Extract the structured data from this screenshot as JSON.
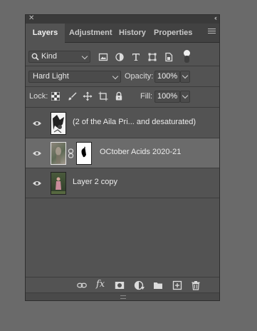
{
  "titlebar": {
    "close_glyph": "✕",
    "collapse_glyph": "‹‹"
  },
  "tabs": [
    {
      "label": "Layers",
      "active": true
    },
    {
      "label": "Adjustment",
      "active": false
    },
    {
      "label": "History",
      "active": false
    },
    {
      "label": "Properties",
      "active": false
    }
  ],
  "filter": {
    "kind_label": "Kind",
    "icons": [
      "image-filter-icon",
      "adjustment-filter-icon",
      "type-filter-icon",
      "shape-filter-icon",
      "smart-object-filter-icon",
      "filter-toggle"
    ]
  },
  "blend": {
    "mode": "Hard Light",
    "opacity_label": "Opacity:",
    "opacity_value": "100%"
  },
  "lock": {
    "label": "Lock:",
    "fill_label": "Fill:",
    "fill_value": "100%"
  },
  "layers": [
    {
      "name": "(2 of the Aila Pri... and desaturated)",
      "visible": true,
      "selected": false,
      "has_mask": false
    },
    {
      "name": "OCtober Acids 2020-21",
      "visible": true,
      "selected": true,
      "has_mask": true
    },
    {
      "name": "Layer 2 copy",
      "visible": true,
      "selected": false,
      "has_mask": false
    }
  ],
  "footer": {
    "fx_label": "fx",
    "icons": [
      "link-layers-icon",
      "fx-icon",
      "add-mask-icon",
      "adjustment-layer-icon",
      "new-group-icon",
      "new-layer-icon",
      "delete-icon"
    ]
  },
  "colors": {
    "panel": "#535353",
    "selected_row": "#6b6b6b",
    "background": "#6a6a6a"
  }
}
